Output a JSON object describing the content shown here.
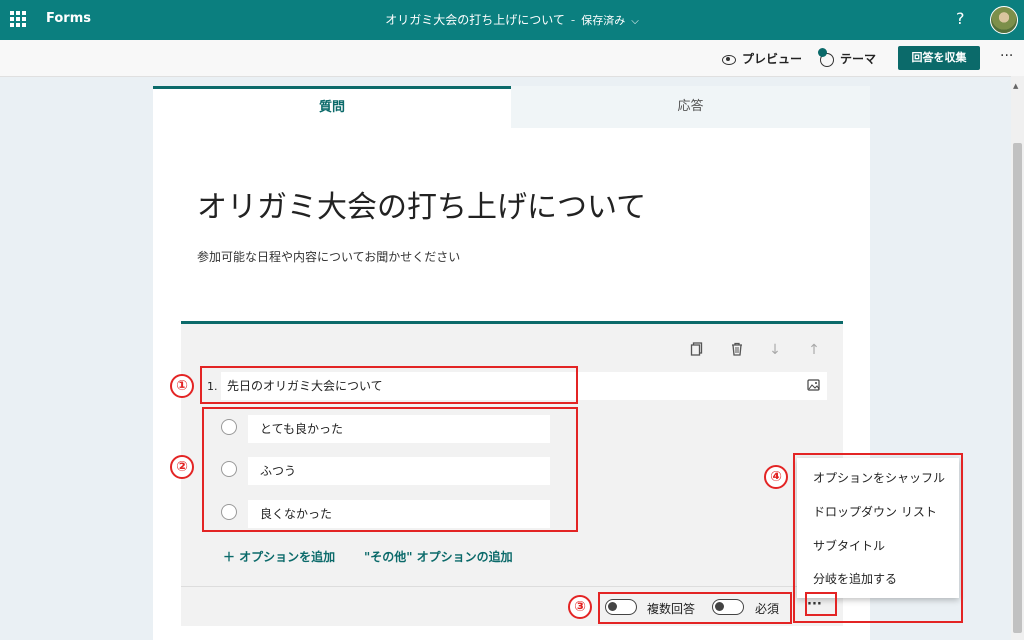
{
  "topbar": {
    "app_name": "Forms",
    "doc_title": "オリガミ大会の打ち上げについて",
    "separator": "-",
    "save_status": "保存済み",
    "help": "?"
  },
  "toolbar": {
    "preview_label": "プレビュー",
    "theme_label": "テーマ",
    "collect_label": "回答を収集",
    "more": "···"
  },
  "tabs": [
    {
      "label": "質問",
      "active": true
    },
    {
      "label": "応答",
      "active": false
    }
  ],
  "form": {
    "title": "オリガミ大会の打ち上げについて",
    "description": "参加可能な日程や内容についてお聞かせください"
  },
  "question": {
    "number": "1.",
    "text": "先日のオリガミ大会について",
    "options": [
      "とても良かった",
      "ふつう",
      "良くなかった"
    ],
    "add_option": "＋ オプションを追加",
    "add_other": "\"その他\" オプションの追加",
    "multi_answer_label": "複数回答",
    "multi_answer_on": false,
    "required_label": "必須",
    "required_on": false,
    "more": "···"
  },
  "context_menu": {
    "items": [
      "オプションをシャッフル",
      "ドロップダウン リスト",
      "サブタイトル",
      "分岐を追加する"
    ]
  },
  "annotations": [
    "①",
    "②",
    "③",
    "④"
  ],
  "colors": {
    "brand": "#0b7f7f",
    "accent": "#0b6a6a",
    "annotation": "#e32424"
  }
}
